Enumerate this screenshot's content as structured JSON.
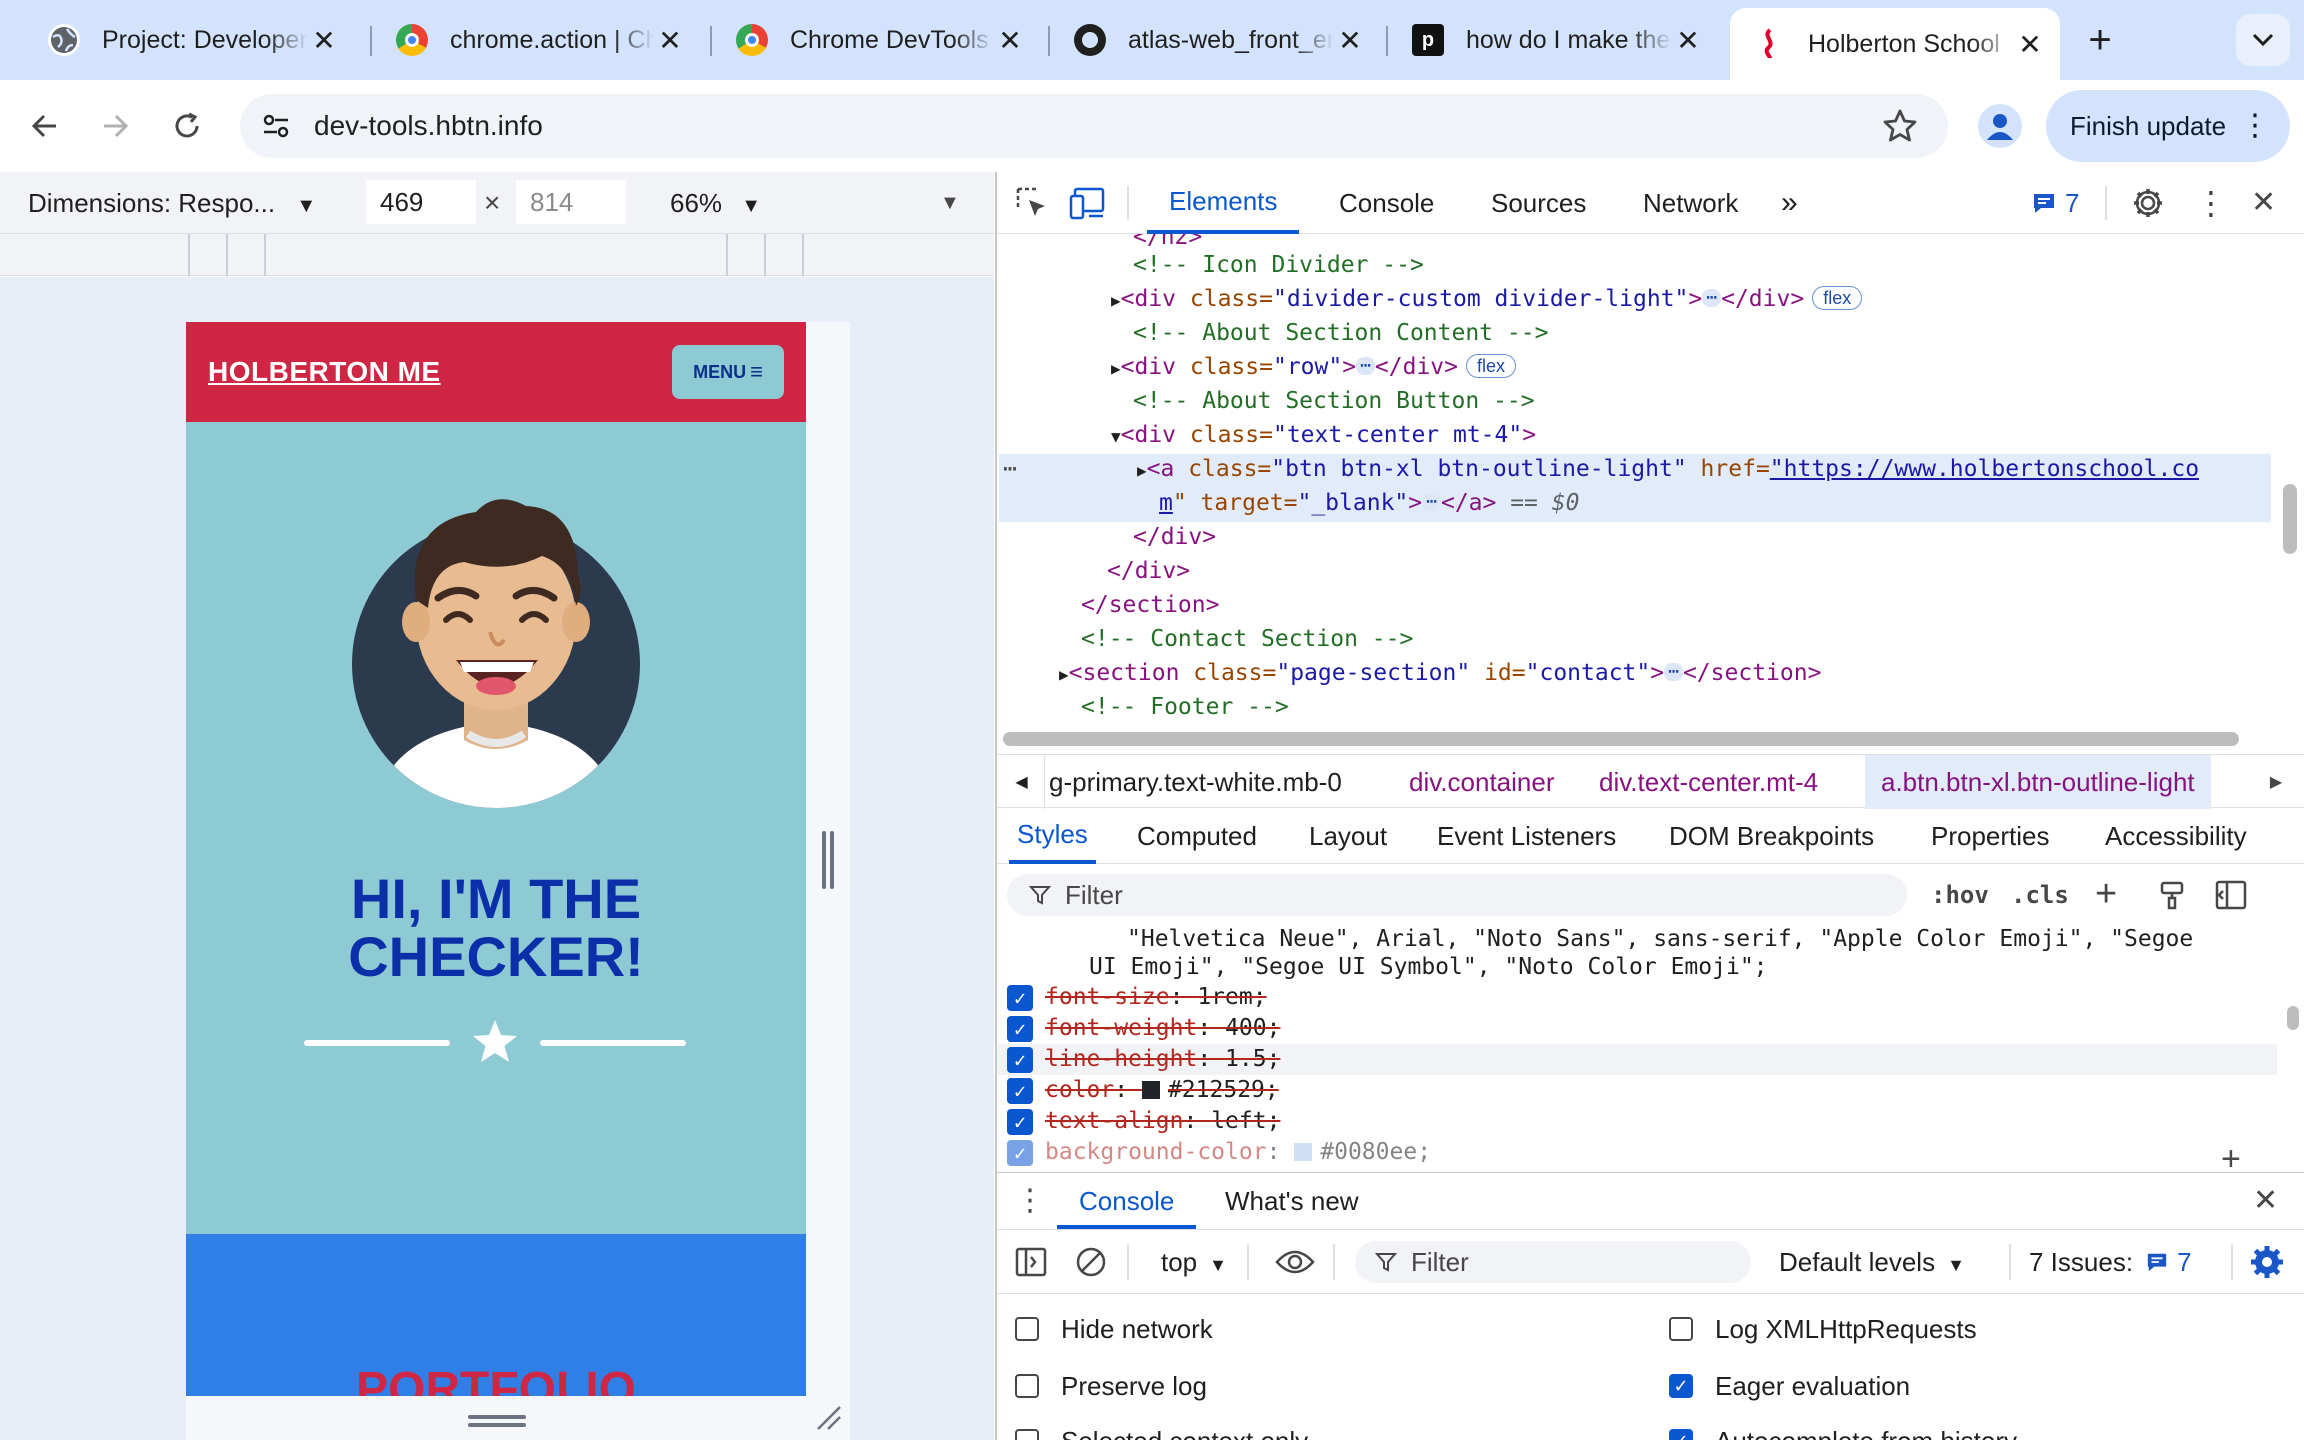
{
  "browser": {
    "tabs": [
      {
        "title": "Project: Developer",
        "icon": "globe-icon"
      },
      {
        "title": "chrome.action | Chrome",
        "icon": "chrome-icon"
      },
      {
        "title": "Chrome DevTools",
        "icon": "chrome-icon"
      },
      {
        "title": "atlas-web_front_end",
        "icon": "github-icon"
      },
      {
        "title": "how do I make the",
        "icon": "perplexity-icon"
      },
      {
        "title": "Holberton School",
        "icon": "holberton-icon",
        "active": true
      }
    ],
    "url": "dev-tools.hbtn.info",
    "finish_update": "Finish update"
  },
  "device_toolbar": {
    "dimensions_label": "Dimensions: Respo...",
    "width": "469",
    "height": "814",
    "zoom": "66%"
  },
  "site": {
    "brand": "HOLBERTON ME",
    "menu": "MENU",
    "hero_title_line1": "HI, I'M THE",
    "hero_title_line2": "CHECKER!",
    "portfolio_heading": "PORTFOLIO"
  },
  "devtools": {
    "tabs": [
      "Elements",
      "Console",
      "Sources",
      "Network"
    ],
    "issues_count": "7",
    "elements": {
      "line0": "</h2>",
      "line1": "<!-- Icon Divider -->",
      "line2_tag": "<div",
      "line2_attr": " class=",
      "line2_val": "\"divider-custom divider-light\"",
      "line2_end": ">",
      "line2_close": "</div>",
      "line3": "<!-- About Section Content -->",
      "line4_val": "\"row\"",
      "line5": "<!-- About Section Button -->",
      "line6_val": "\"text-center mt-4\"",
      "line7_tag": "<a",
      "line7_attr": " class=",
      "line7_val": "\"btn btn-xl btn-outline-light\"",
      "line7_href_attr": " href=",
      "line7_href_val": "\"https://www.holbertonschool.co",
      "line8_href_tail": "m",
      "line8_target_attr": "\" target=",
      "line8_target_val": "\"_blank\"",
      "line8_end": ">",
      "line8_close": "</a>",
      "line8_eq": " == $0",
      "line9": "</div>",
      "line10": "</div>",
      "line11": "</section>",
      "line12": "<!-- Contact Section -->",
      "line13_tag": "<section",
      "line13_class_val": "\"page-section\"",
      "line13_id_attr": " id=",
      "line13_id_val": "\"contact\"",
      "line13_close": "</section>",
      "line14": "<!-- Footer -->",
      "flex_badge": "flex",
      "ellipsis": "⋯"
    },
    "breadcrumbs": [
      "g-primary.text-white.mb-0",
      "div.container",
      "div.text-center.mt-4",
      "a.btn.btn-xl.btn-outline-light"
    ],
    "sub_tabs": [
      "Styles",
      "Computed",
      "Layout",
      "Event Listeners",
      "DOM Breakpoints",
      "Properties",
      "Accessibility"
    ],
    "styles_filter_placeholder": "Filter",
    "hov": ":hov",
    "cls": ".cls",
    "styles": {
      "font_line1": "\"Helvetica Neue\", Arial, \"Noto Sans\", sans-serif, \"Apple Color Emoji\", \"Segoe",
      "font_line2": "UI Emoji\", \"Segoe UI Symbol\", \"Noto Color Emoji\";",
      "rules": [
        {
          "prop": "font-size",
          "value": "1rem;"
        },
        {
          "prop": "font-weight",
          "value": "400;"
        },
        {
          "prop": "line-height",
          "value": "1.5;"
        },
        {
          "prop": "color",
          "value": "#212529;",
          "swatch": "#212529"
        },
        {
          "prop": "text-align",
          "value": "left;"
        },
        {
          "prop": "background-color",
          "value": "#0080ee;",
          "swatch": "#a8c8f0"
        }
      ]
    },
    "drawer": {
      "tabs": [
        "Console",
        "What's new"
      ],
      "context": "top",
      "filter_placeholder": "Filter",
      "levels": "Default levels",
      "issues_label": "7 Issues:",
      "issues_count": "7",
      "options": [
        {
          "label": "Hide network",
          "checked": false
        },
        {
          "label": "Log XMLHttpRequests",
          "checked": false
        },
        {
          "label": "Preserve log",
          "checked": false
        },
        {
          "label": "Eager evaluation",
          "checked": true
        },
        {
          "label": "Selected context only",
          "checked": false
        },
        {
          "label": "Autocomplete from history",
          "checked": true
        }
      ]
    }
  },
  "colors": {
    "accent": "#0b57d0",
    "site_red": "#cf2743",
    "site_teal": "#8ecad3",
    "site_blue": "#2f7fe7",
    "site_navy": "#0a2fa8"
  }
}
